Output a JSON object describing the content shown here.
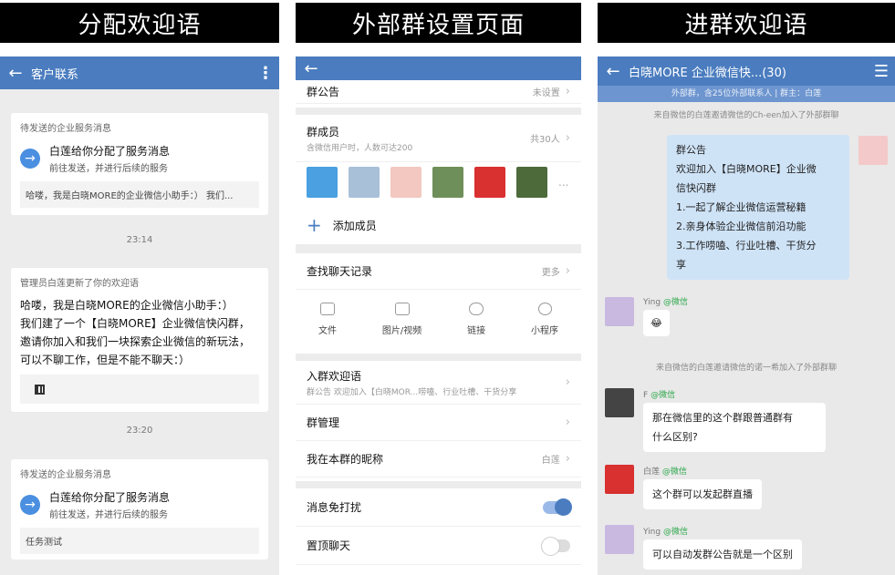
{
  "banners": {
    "p1": "分配欢迎语",
    "p2": "外部群设置页面",
    "p3": "进群欢迎语"
  },
  "p1": {
    "title": "客户联系",
    "card1": {
      "head": "待发送的企业服务消息",
      "title": "白莲给你分配了服务消息",
      "sub": "前往发送，并进行后续的服务",
      "preview": "哈喽，我是白晓MORE的企业微信小助手：）  我们..."
    },
    "time1": "23:14",
    "card2": {
      "head": "管理员白莲更新了你的欢迎语",
      "lines": [
        "哈喽，我是白晓MORE的企业微信小助手：）",
        "我们建了一个【白晓MORE】企业微信快闪群，",
        "邀请你加入和我们一块探索企业微信的新玩法，",
        "可以不聊工作，但是不能不聊天：）"
      ]
    },
    "time2": "23:20",
    "card3": {
      "head": "待发送的企业服务消息",
      "title": "白莲给你分配了服务消息",
      "sub": "前往发送，并进行后续的服务",
      "preview": "任务测试"
    }
  },
  "p2": {
    "notice": {
      "label": "群公告",
      "value": "未设置"
    },
    "members": {
      "label": "群成员",
      "sub": "含微信用户时，人数可达200",
      "value": "共30人"
    },
    "add_member": "添加成员",
    "history": {
      "label": "查找聊天记录",
      "value": "更多"
    },
    "types": [
      "文件",
      "图片/视频",
      "链接",
      "小程序"
    ],
    "welcome": {
      "label": "入群欢迎语",
      "sub": "群公告 欢迎加入【白晓MOR...唠嗑、行业吐槽、干货分享"
    },
    "manage": "群管理",
    "nickname": {
      "label": "我在本群的昵称",
      "value": "白莲"
    },
    "dnd": "消息免打扰",
    "pin": "置顶聊天",
    "more": "..."
  },
  "p3": {
    "title": "白晓MORE 企业微信快...(30)",
    "subtitle": "外部群，含25位外部联系人 | 群主：白莲",
    "sys1": "来自微信的白莲邀请微信的Ch-een加入了外部群聊",
    "notice_lines": [
      "群公告",
      "欢迎加入【白晓MORE】企业微",
      "信快闪群",
      "1.一起了解企业微信运营秘籍",
      "2.亲身体验企业微信前沿功能",
      "3.工作唠嗑、行业吐槽、干货分",
      "享"
    ],
    "m1": {
      "name": "Ying",
      "tag": "@微信",
      "text": "😂"
    },
    "sys2": "来自微信的白莲邀请微信的诺一希加入了外部群聊",
    "m2": {
      "name": "F",
      "tag": "@微信",
      "lines": [
        "那在微信里的这个群跟普通群有",
        "什么区别?"
      ]
    },
    "m3": {
      "name": "白莲",
      "tag": "@微信",
      "text": "这个群可以发起群直播"
    },
    "m4": {
      "name": "Ying",
      "tag": "@微信",
      "text": "可以自动发群公告就是一个区别"
    }
  }
}
